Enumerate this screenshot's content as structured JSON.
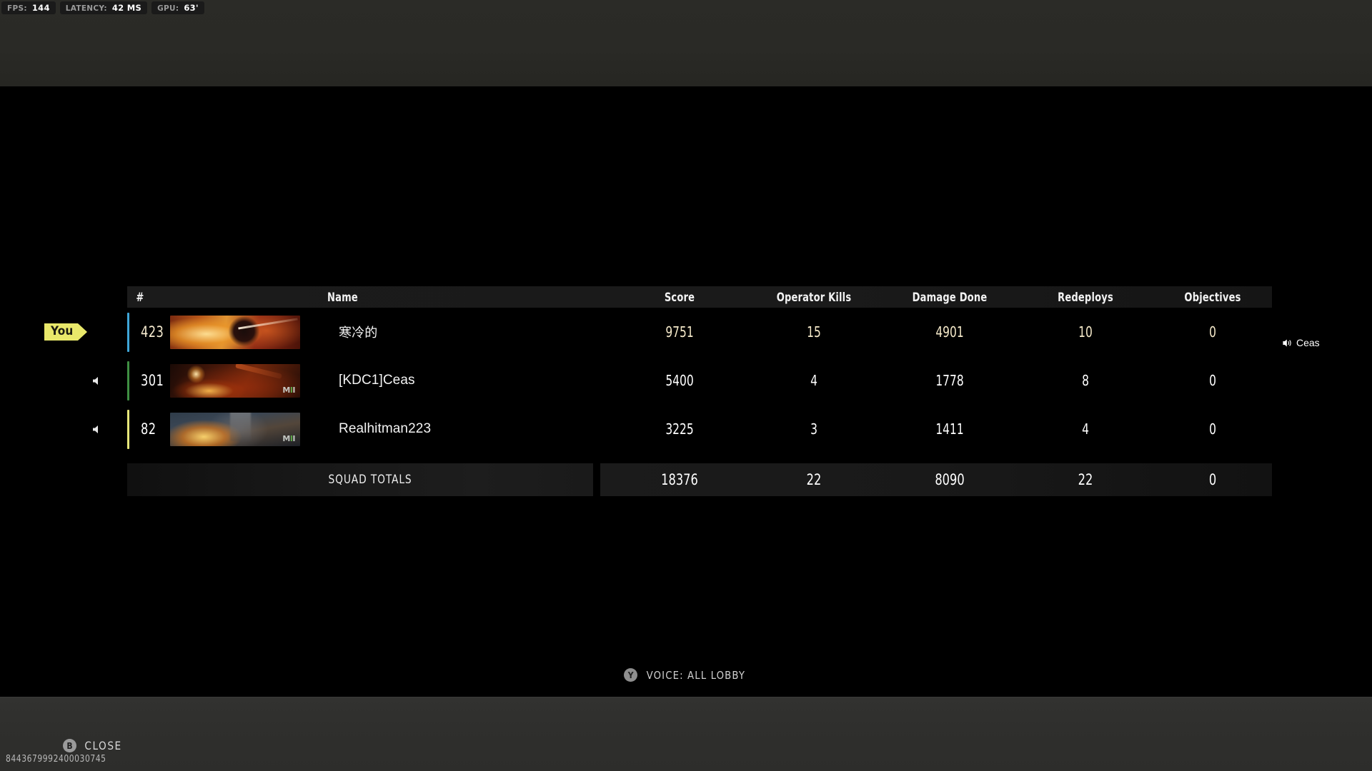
{
  "perf_hud": {
    "items": [
      {
        "label": "FPS:",
        "value": "144",
        "name": "fps"
      },
      {
        "label": "LATENCY:",
        "value": "42 MS",
        "name": "latency"
      },
      {
        "label": "GPU:",
        "value": "63'",
        "name": "gpu"
      }
    ]
  },
  "scoreboard": {
    "headers": {
      "rank": "#",
      "name": "Name",
      "score": "Score",
      "operator_kills": "Operator Kills",
      "damage_done": "Damage Done",
      "redeploys": "Redeploys",
      "objectives": "Objectives"
    },
    "you_badge": "You",
    "rows": [
      {
        "rank": "423",
        "name": "寒冷的",
        "score": "9751",
        "operator_kills": "15",
        "damage_done": "4901",
        "redeploys": "10",
        "objectives": "0",
        "accent_color": "#3fa6d8",
        "is_you": true,
        "muted_icon": false,
        "emblem_logo": "MWII"
      },
      {
        "rank": "301",
        "name": "[KDC1]Ceas",
        "score": "5400",
        "operator_kills": "4",
        "damage_done": "1778",
        "redeploys": "8",
        "objectives": "0",
        "accent_color": "#3f8f43",
        "is_you": false,
        "muted_icon": true,
        "emblem_logo": "MWII"
      },
      {
        "rank": "82",
        "name": "Realhitman223",
        "score": "3225",
        "operator_kills": "3",
        "damage_done": "1411",
        "redeploys": "4",
        "objectives": "0",
        "accent_color": "#e7e77a",
        "is_you": false,
        "muted_icon": true,
        "emblem_logo": "MWII"
      }
    ],
    "totals": {
      "label": "SQUAD TOTALS",
      "score": "18376",
      "operator_kills": "22",
      "damage_done": "8090",
      "redeploys": "22",
      "objectives": "0"
    }
  },
  "voice_chat_indicator": {
    "speaker_name": "Ceas"
  },
  "voice_prompt": {
    "key": "Y",
    "text": "VOICE: ALL LOBBY"
  },
  "close_button": {
    "key": "B",
    "label": "CLOSE"
  },
  "match_id": "8443679992400030745",
  "colors": {
    "you_badge": "#e9e86a",
    "accent_blue": "#3fa6d8",
    "accent_green": "#3f8f43",
    "accent_yellow": "#e7e77a",
    "text_primary": "#ffffff",
    "text_warm": "#f5e9c9",
    "background": "#000000"
  }
}
